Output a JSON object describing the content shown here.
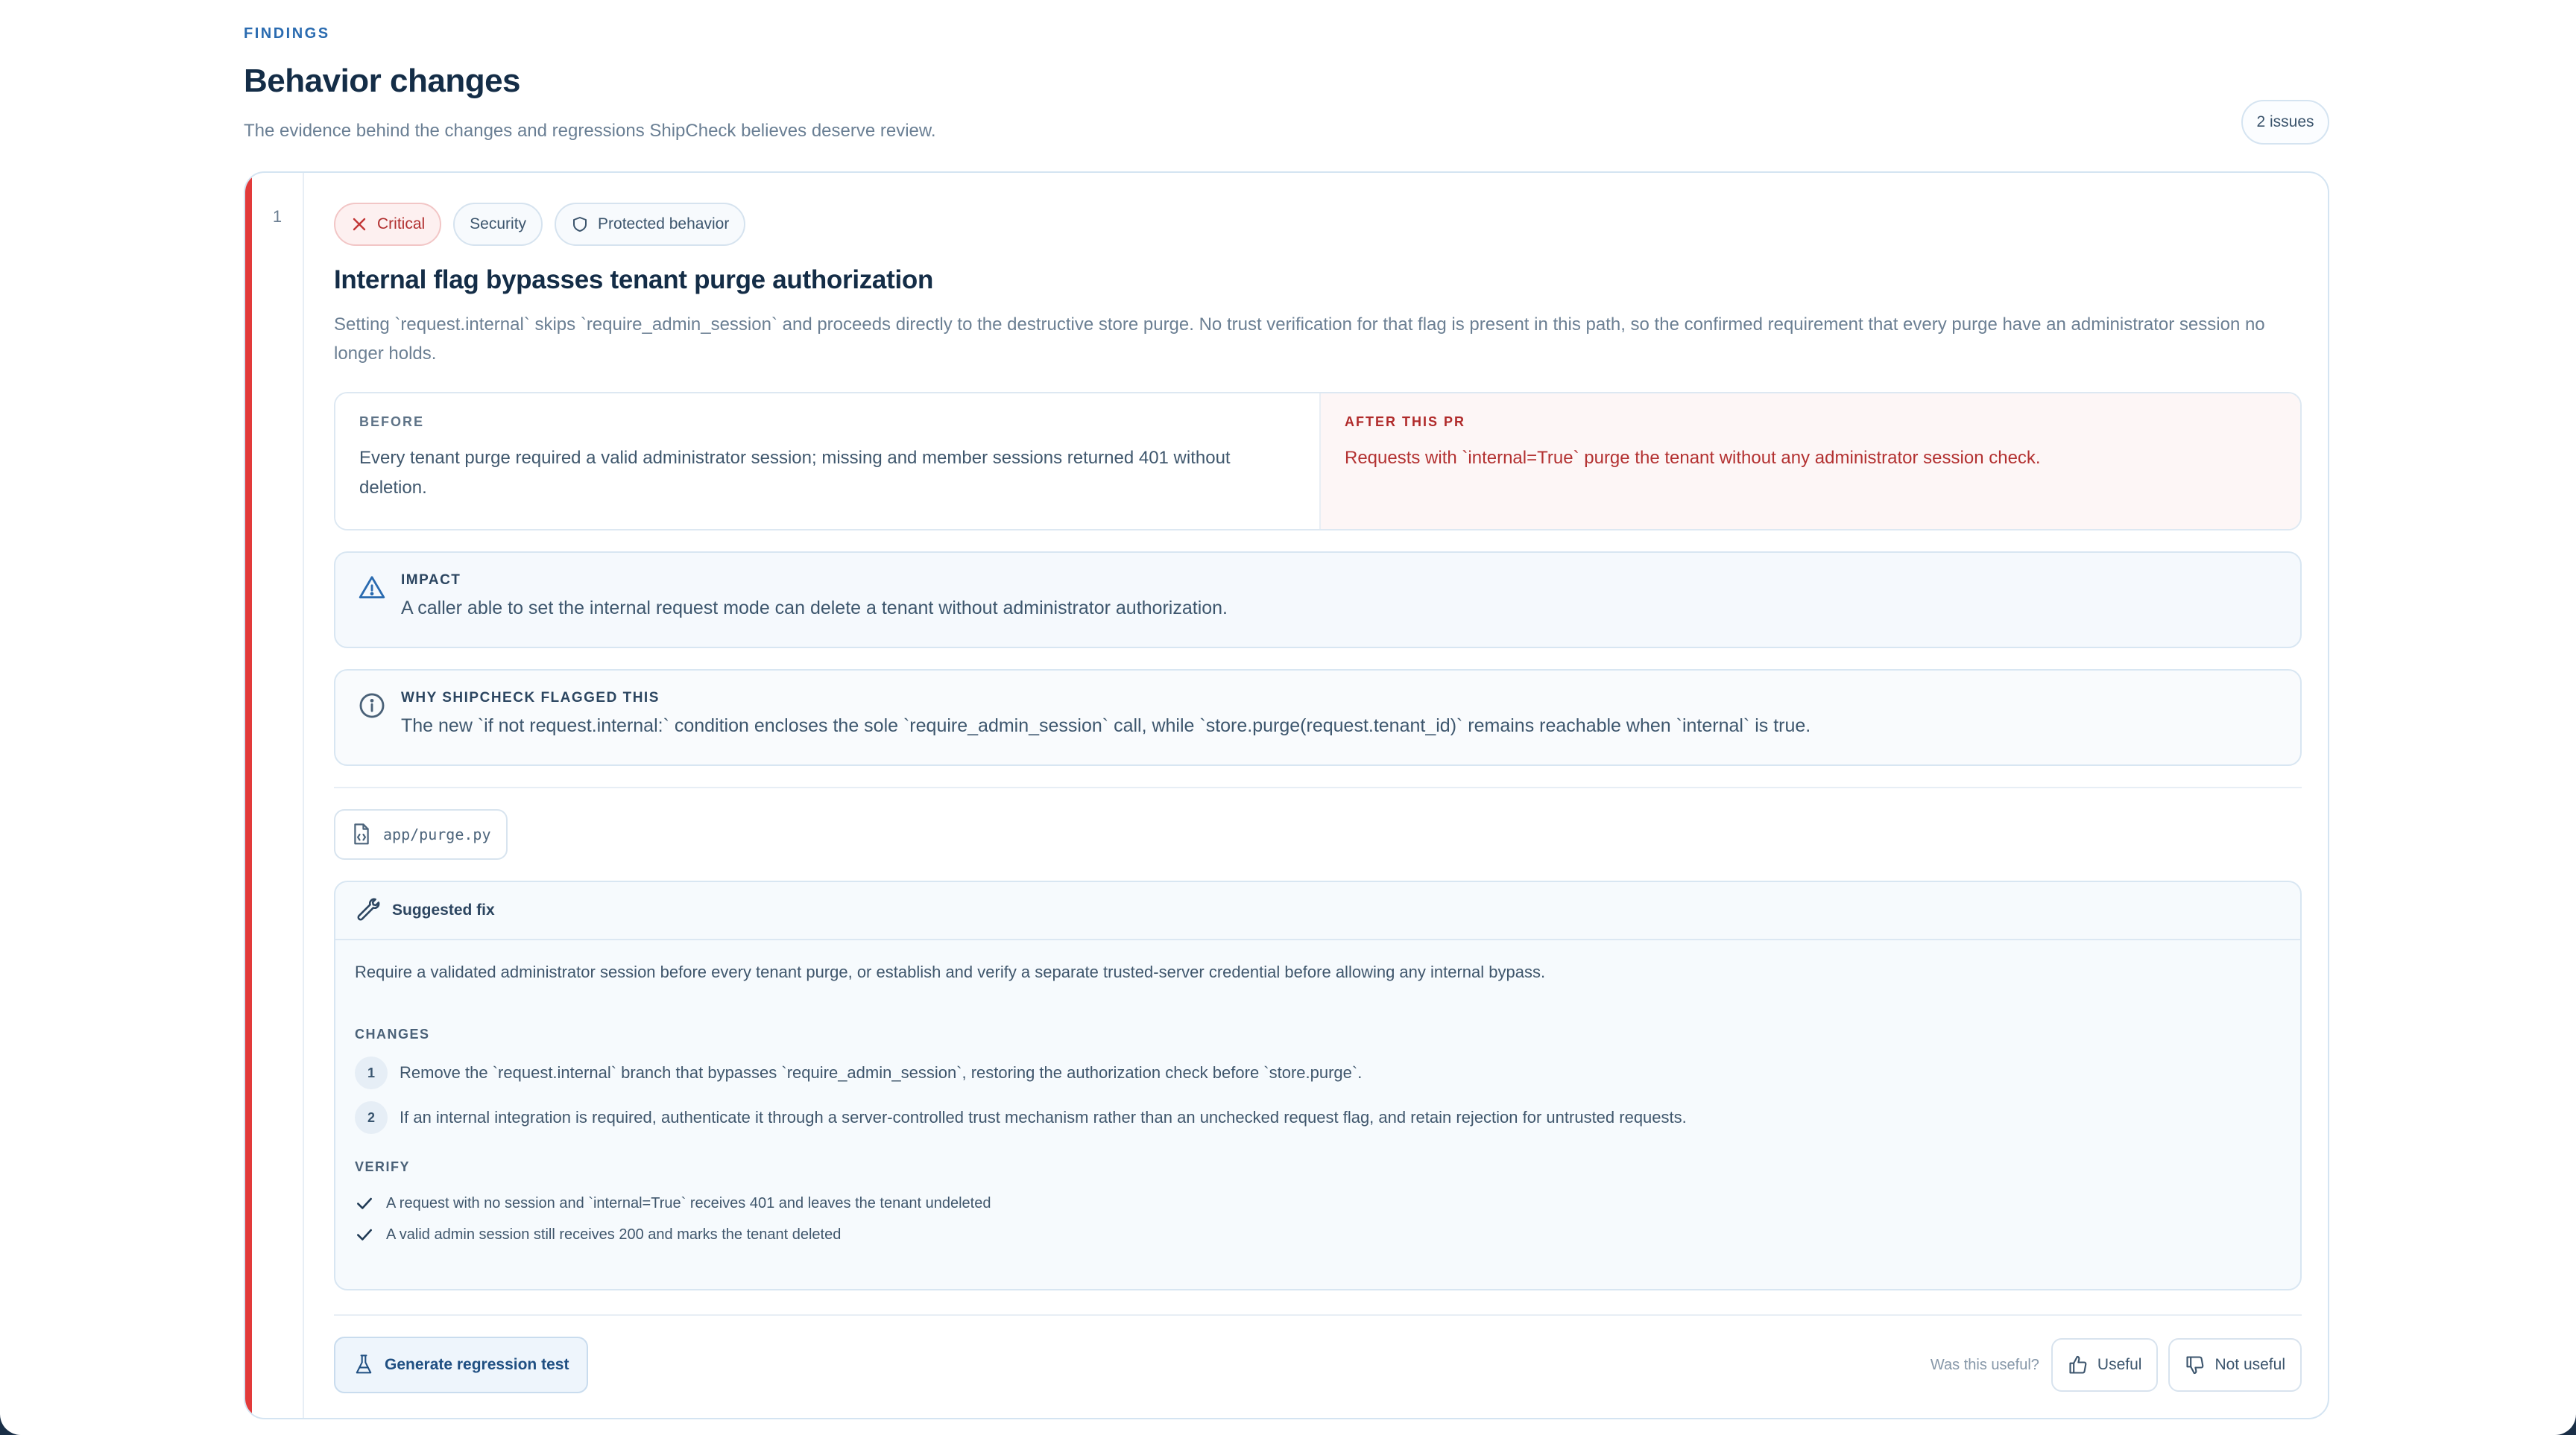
{
  "header": {
    "eyebrow": "FINDINGS",
    "title": "Behavior changes",
    "subtitle": "The evidence behind the changes and regressions ShipCheck believes deserve review.",
    "issue_count": "2 issues"
  },
  "finding": {
    "number": "1",
    "tags": {
      "severity": "Critical",
      "category": "Security",
      "kind": "Protected behavior"
    },
    "title": "Internal flag bypasses tenant purge authorization",
    "description": "Setting `request.internal` skips `require_admin_session` and proceeds directly to the destructive store purge. No trust verification for that flag is present in this path, so the confirmed requirement that every purge have an administrator session no longer holds.",
    "before_label": "BEFORE",
    "before_text": "Every tenant purge required a valid administrator session; missing and member sessions returned 401 without deletion.",
    "after_label": "AFTER THIS PR",
    "after_text": "Requests with `internal=True` purge the tenant without any administrator session check.",
    "impact_label": "IMPACT",
    "impact_text": "A caller able to set the internal request mode can delete a tenant without administrator authorization.",
    "why_label": "WHY SHIPCHECK FLAGGED THIS",
    "why_text": "The new `if not request.internal:` condition encloses the sole `require_admin_session` call, while `store.purge(request.tenant_id)` remains reachable when `internal` is true.",
    "file": "app/purge.py",
    "suggested_fix": {
      "heading": "Suggested fix",
      "description": "Require a validated administrator session before every tenant purge, or establish and verify a separate trusted-server credential before allowing any internal bypass.",
      "changes_label": "CHANGES",
      "changes": [
        {
          "n": "1",
          "text": "Remove the `request.internal` branch that bypasses `require_admin_session`, restoring the authorization check before `store.purge`."
        },
        {
          "n": "2",
          "text": "If an internal integration is required, authenticate it through a server-controlled trust mechanism rather than an unchecked request flag, and retain rejection for untrusted requests."
        }
      ],
      "verify_label": "VERIFY",
      "verify": [
        "A request with no session and `internal=True` receives 401 and leaves the tenant undeleted",
        "A valid admin session still receives 200 and marks the tenant deleted"
      ]
    },
    "actions": {
      "generate": "Generate regression test",
      "feedback_question": "Was this useful?",
      "useful": "Useful",
      "not_useful": "Not useful"
    }
  },
  "colors": {
    "accent_critical": "#e23a3a",
    "brand_blue": "#2a6bb0",
    "page_frame": "#1a2f47"
  },
  "icons": [
    "x-icon",
    "shield-icon",
    "warning-icon",
    "info-icon",
    "file-icon",
    "wrench-icon",
    "check-icon",
    "flask-icon",
    "thumbs-up-icon",
    "thumbs-down-icon"
  ]
}
